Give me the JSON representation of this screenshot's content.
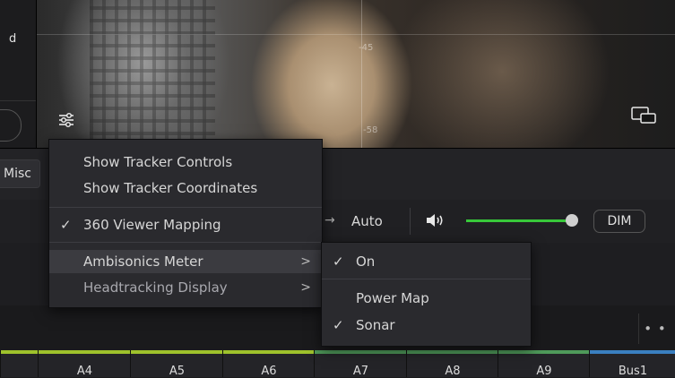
{
  "viewer": {
    "left_label": "d",
    "grid_labels": [
      "-45",
      "-58"
    ],
    "settings_icon": "sliders-icon",
    "pip_icon": "picture-in-picture-icon"
  },
  "toolbar": {
    "misc_tab": "Misc",
    "auto_label": "Auto",
    "dim_label": "DIM",
    "more_label": "• • •",
    "speaker_icon": "speaker-icon",
    "volume_level": 0.95,
    "accent_green": "#38c83a"
  },
  "tracks": [
    {
      "label": "A4",
      "color": "#9fc22c"
    },
    {
      "label": "A5",
      "color": "#9fc22c"
    },
    {
      "label": "A6",
      "color": "#9fc22c"
    },
    {
      "label": "A7",
      "color": "#4f9a5a"
    },
    {
      "label": "A8",
      "color": "#4f9a5a"
    },
    {
      "label": "A9",
      "color": "#4f9a5a"
    },
    {
      "label": "Bus1",
      "color": "#3a7fc0"
    }
  ],
  "menu": {
    "items": [
      {
        "label": "Show Tracker Controls",
        "checked": false
      },
      {
        "label": "Show Tracker Coordinates",
        "checked": false
      },
      {
        "label": "360 Viewer Mapping",
        "checked": true
      },
      {
        "label": "Ambisonics Meter",
        "submenu": true,
        "highlighted": true
      },
      {
        "label": "Headtracking Display",
        "submenu": true
      }
    ],
    "submenu_arrow": ">",
    "check_mark": "✓"
  },
  "submenu": {
    "items": [
      {
        "label": "On",
        "checked": true
      },
      {
        "label": "Power Map",
        "checked": false
      },
      {
        "label": "Sonar",
        "checked": true
      }
    ]
  }
}
